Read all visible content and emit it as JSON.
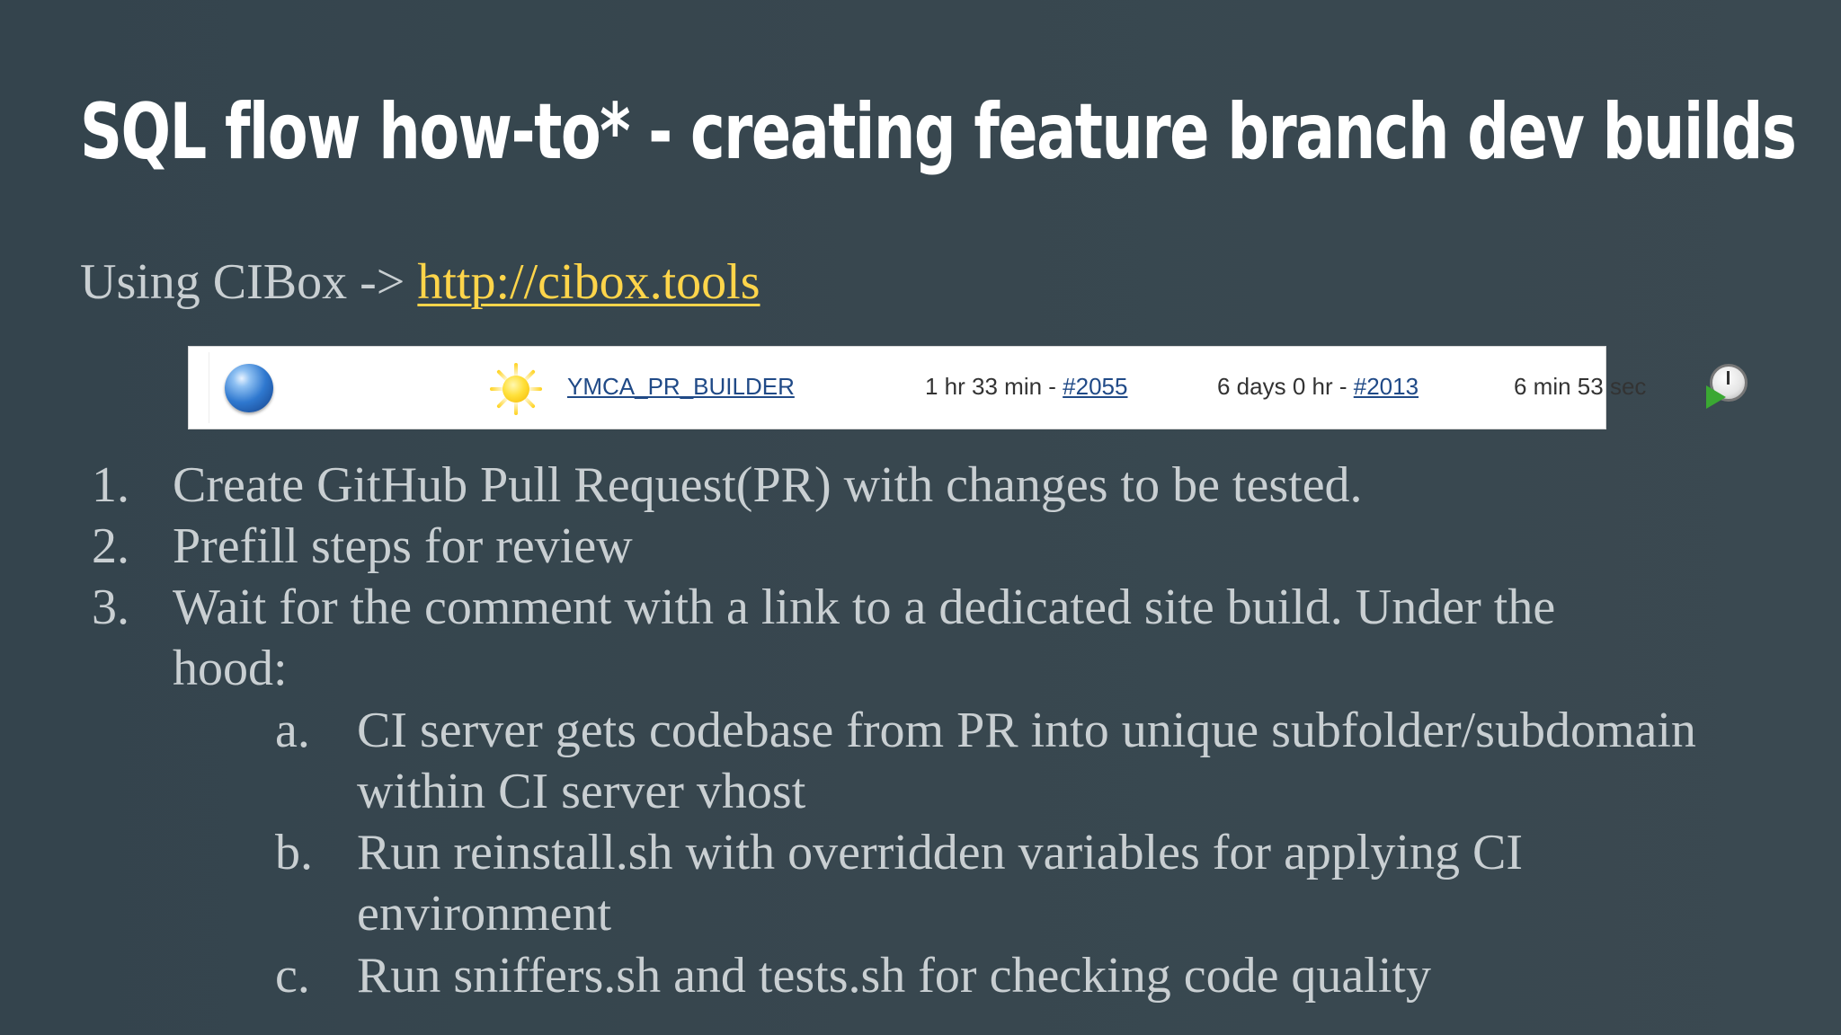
{
  "slide": {
    "title": "SQL flow how-to* - creating feature branch dev builds",
    "subtitle_prefix": "Using CIBox ->",
    "subtitle_link": "http://cibox.tools"
  },
  "job_row": {
    "status_icon": "blue-ball-icon",
    "weather_icon": "sunny-icon",
    "job_name": "YMCA_PR_BUILDER",
    "last_success_time": "1 hr 33 min - ",
    "last_success_build": "#2055",
    "last_failure_time": "6 days 0 hr - ",
    "last_failure_build": "#2013",
    "last_duration": "6 min 53 sec",
    "build_icon": "schedule-build-icon"
  },
  "steps": [
    {
      "num": "1.",
      "text": "Create GitHub Pull Request(PR) with changes to be tested."
    },
    {
      "num": "2.",
      "text": "Prefill steps for review"
    },
    {
      "num": "3.",
      "text_line1": "Wait for the comment with a link to a dedicated site build. Under the",
      "text_line2": "hood:"
    }
  ],
  "substeps": [
    {
      "num": "a.",
      "line1": "CI server gets codebase from PR into unique subfolder/subdomain",
      "line2": "within CI server vhost"
    },
    {
      "num": "b.",
      "line1": "Run reinstall.sh with overridden variables for applying CI",
      "line2": "environment"
    },
    {
      "num": "c.",
      "line1": "Run sniffers.sh and tests.sh for checking code quality"
    }
  ],
  "colors": {
    "background": "#36454e",
    "title": "#ffffff",
    "body_text": "#c9cfd2",
    "link": "#ffd54a",
    "jenkins_link": "#204a87"
  }
}
